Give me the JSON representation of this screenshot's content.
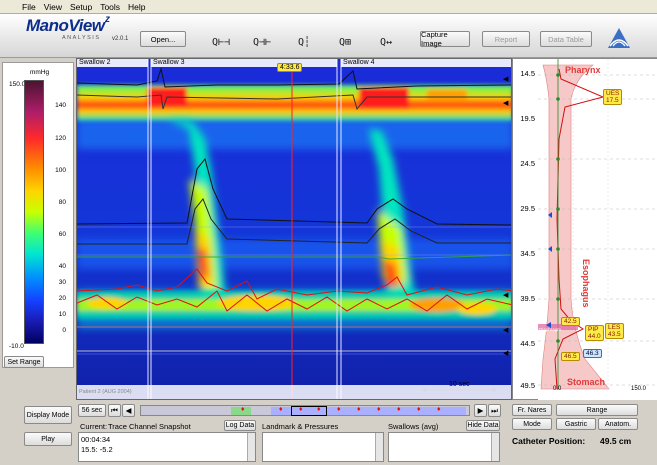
{
  "menu": [
    "File",
    "View",
    "Setup",
    "Tools",
    "Help"
  ],
  "app": {
    "title": "ManoView",
    "suffix": "z",
    "subtitle": "ANALYSIS",
    "version": "v2.0.1"
  },
  "toolbar": {
    "open": "Open...",
    "capture": "Capture Image",
    "report": "Report",
    "data_table": "Data Table"
  },
  "scale": {
    "unit": "mmHg",
    "max": "150.0",
    "min": "-10.0",
    "ticks": [
      "140",
      "120",
      "100",
      "80",
      "60",
      "40",
      "30",
      "20",
      "10",
      "0"
    ],
    "set_range": "Set Range"
  },
  "plot": {
    "swallows": [
      "Swallow 2",
      "Swallow 3",
      "Swallow 4"
    ],
    "time_marker": "4:33.6",
    "footer_text": "Patient 2 (AUG 2004)",
    "scale_bar": "10 sec",
    "depth_ticks": [
      "14.5",
      "19.5",
      "24.5",
      "29.5",
      "34.5",
      "39.5",
      "44.5",
      "49.5"
    ]
  },
  "anatomy": {
    "pharynx": "Pharynx",
    "esophagus": "Esophagus",
    "stomach": "Stomach",
    "ues_label": "UES",
    "ues_value": "17.5",
    "les_label": "LES",
    "les_value": "43.5",
    "pip_label": "PIP",
    "pip_value": "44.0",
    "v1": "42.5",
    "v2": "46.5",
    "v3": "46.3",
    "axis_min": "0.0",
    "axis_max": "150.0",
    "diaphragm": "Diaphragm"
  },
  "controls": {
    "display_mode": "Display Mode",
    "play": "Play",
    "interval": "56 sec",
    "current_label": "Current:",
    "current_value": "Trace Channel Snapshot",
    "log_data": "Log Data",
    "landmark": "Landmark & Pressures",
    "swallows_avg": "Swallows (avg)",
    "hide_data": "Hide Data",
    "readout1": "00:04:34",
    "readout2": "15.5: -5.2",
    "fr_nares": "Fr. Nares",
    "range": "Range",
    "mode": "Mode",
    "gastric": "Gastric",
    "anatom": "Anatom.",
    "catheter_label": "Catheter Position:",
    "catheter_value": "49.5 cm"
  },
  "colors": {
    "brand": "#0c2e8a",
    "trace_red": "#e01010",
    "trace_dark": "#111111"
  }
}
